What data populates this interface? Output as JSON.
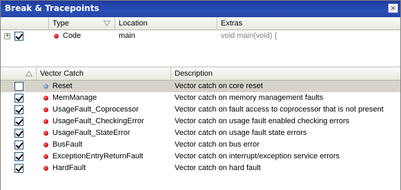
{
  "window": {
    "title": "Break & Tracepoints",
    "close_glyph": "×"
  },
  "tracepoints": {
    "columns": [
      "",
      "Type",
      "Location",
      "Extras"
    ],
    "rows": [
      {
        "expander": "+",
        "checked": true,
        "type": "Code",
        "location": "main",
        "extras": "void main(void) {",
        "icon": "red-breakpoint-dot"
      }
    ]
  },
  "vector_catch": {
    "columns": [
      "",
      "Vector Catch",
      "Description"
    ],
    "rows": [
      {
        "checked": false,
        "name": "Reset",
        "description": "Vector catch on core reset",
        "icon": "blue-dot"
      },
      {
        "checked": true,
        "name": "MemManage",
        "description": "Vector catch on memory management faults",
        "icon": "red-dot"
      },
      {
        "checked": true,
        "name": "UsageFault_Coprocessor",
        "description": "Vector catch on fault access to coprocessor that is not present",
        "icon": "red-dot"
      },
      {
        "checked": true,
        "name": "UsageFault_CheckingError",
        "description": "Vector catch on usage fault enabled checking errors",
        "icon": "red-dot"
      },
      {
        "checked": true,
        "name": "UsageFault_StateError",
        "description": "Vector catch on usage fault state errors",
        "icon": "red-dot"
      },
      {
        "checked": true,
        "name": "BusFault",
        "description": "Vector catch on bus error",
        "icon": "red-dot"
      },
      {
        "checked": true,
        "name": "ExceptionEntryReturnFault",
        "description": "Vector catch on interrupt/exception service errors",
        "icon": "red-dot"
      },
      {
        "checked": true,
        "name": "HardFault",
        "description": "Vector catch on hard fault",
        "icon": "red-dot"
      }
    ]
  }
}
